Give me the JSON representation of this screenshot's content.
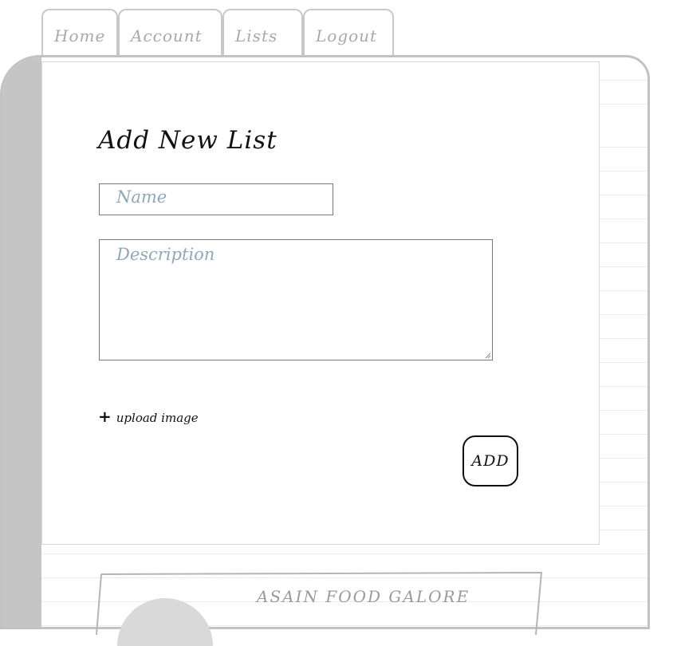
{
  "nav": {
    "tabs": [
      {
        "label": "Home"
      },
      {
        "label": "Account"
      },
      {
        "label": "Lists"
      },
      {
        "label": "Logout"
      }
    ]
  },
  "form": {
    "title": "Add New List",
    "name_placeholder": "Name",
    "description_placeholder": "Description",
    "upload_label": "upload image",
    "upload_icon": "plus-icon",
    "add_label": "ADD"
  },
  "lists": [
    {
      "title": "ASAIN FOOD GALORE"
    }
  ],
  "colors": {
    "border": "#c2c2c2",
    "spine": "#c5c5c5",
    "placeholder": "#8fa9b8",
    "tab_text": "#a9a9a9"
  }
}
